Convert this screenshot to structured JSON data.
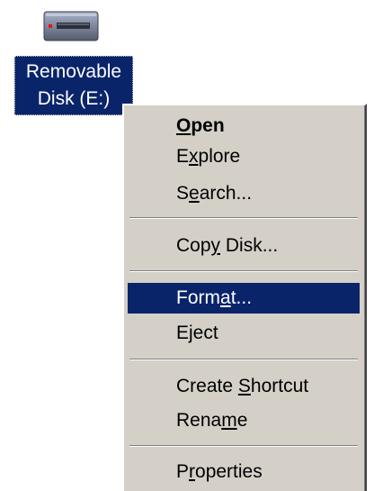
{
  "desktop_icon": {
    "label_line1": "Removable",
    "label_line2": "Disk (E:)",
    "icon": "removable-drive-icon"
  },
  "context_menu": {
    "items": [
      {
        "before": "",
        "mnemonic": "O",
        "after": "pen",
        "default": true
      },
      {
        "before": "E",
        "mnemonic": "x",
        "after": "plore"
      },
      {
        "before": "S",
        "mnemonic": "e",
        "after": "arch..."
      },
      {
        "before": "Cop",
        "mnemonic": "y",
        "after": " Disk..."
      },
      {
        "before": "Form",
        "mnemonic": "a",
        "after": "t...",
        "selected": true
      },
      {
        "before": "Eject",
        "mnemonic": "",
        "after": ""
      },
      {
        "before": "Create ",
        "mnemonic": "S",
        "after": "hortcut"
      },
      {
        "before": "Rena",
        "mnemonic": "m",
        "after": "e"
      },
      {
        "before": "P",
        "mnemonic": "r",
        "after": "operties"
      }
    ]
  },
  "colors": {
    "menu_background": "#d4d0c8",
    "selection": "#0a246a",
    "selection_text": "#ffffff"
  }
}
